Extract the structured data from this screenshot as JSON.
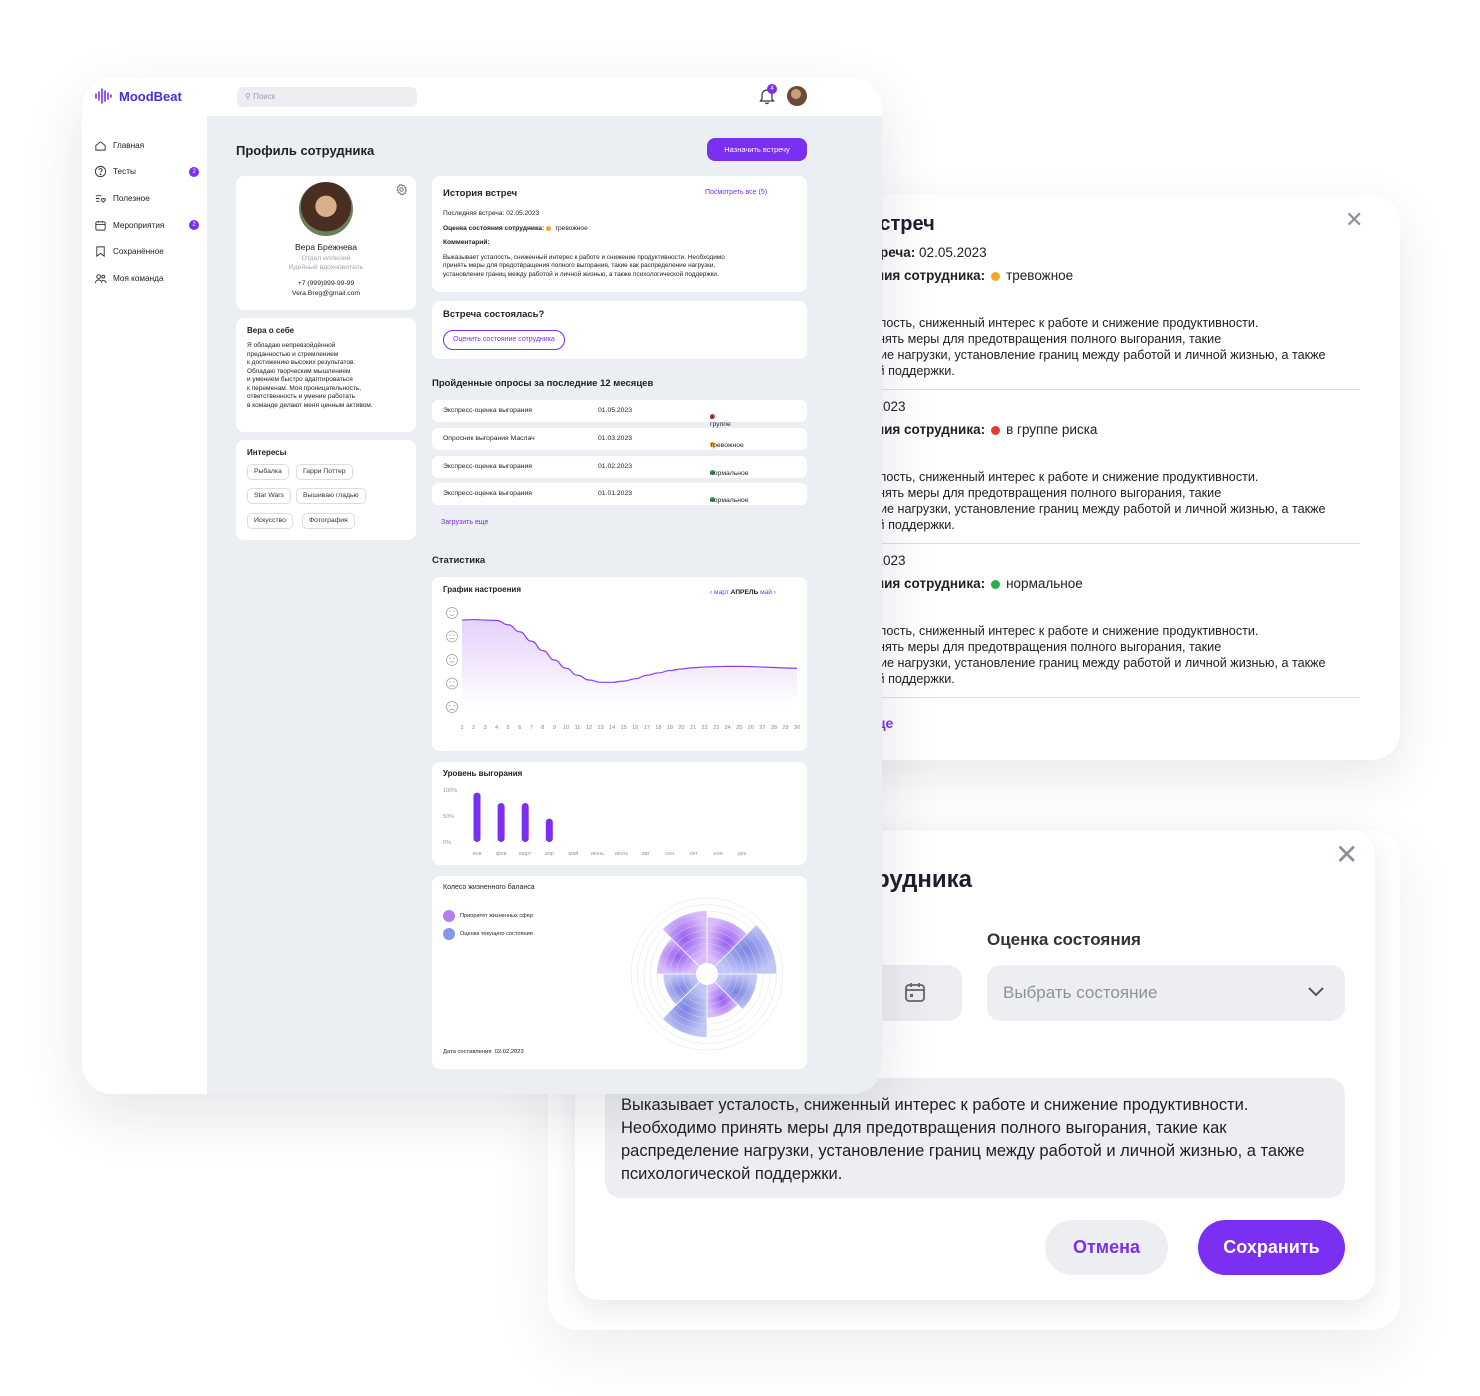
{
  "history_panel": {
    "title": "ия встреч",
    "entries": [
      {
        "date_line": "ия встреча:",
        "date": "02.05.2023",
        "state_label": "остояния сотрудника:",
        "state_color": "#f5a623",
        "state": "тревожное",
        "comment_label": "арий:",
        "lines": [
          "ет усталость, сниженный интерес к работе и снижение продуктивности.",
          "мо принять меры для предотвращения полного выгорания, такие",
          "еделение нагрузки, установление границ между работой и личной жизнью, а также",
          "ической поддержки."
        ]
      },
      {
        "date_line": "",
        "date": "02.04.2023",
        "state_label": "остояния сотрудника:",
        "state_color": "#e53935",
        "state": "в группе риска",
        "comment_label": "арий:",
        "lines": [
          "ет усталость, сниженный интерес к работе и снижение продуктивности.",
          "мо принять меры для предотвращения полного выгорания, такие",
          "еделение нагрузки, установление границ между работой и личной жизнью, а также",
          "ической поддержки."
        ]
      },
      {
        "date_line": "",
        "date": "02.03.2023",
        "state_label": "остояния сотрудника:",
        "state_color": "#22b14c",
        "state": "нормальное",
        "comment_label": "арий:",
        "lines": [
          "ет усталость, сниженный интерес к работе и снижение продуктивности.",
          "мо принять меры для предотвращения полного выгорания, такие",
          "еделение нагрузки, установление границ между работой и личной жизнью, а также",
          "ической поддержки."
        ]
      }
    ],
    "more": "ить еще"
  },
  "edit_panel": {
    "title": "рудника",
    "state_label": "Оценка состояния",
    "select_placeholder": "Выбрать состояние",
    "comment": "Выказывает усталость, сниженный интерес к работе и снижение продуктивности. Необходимо принять меры для предотвращения полного выгорания, такие как распределение нагрузки, установление границ между работой и личной жизнью, а также психологической поддержки.",
    "cancel": "Отмена",
    "save": "Сохранить"
  },
  "app": {
    "brand": "MoodBeat",
    "search_placeholder": "Поиск",
    "notifications": "4",
    "nav": [
      {
        "label": "Главная",
        "icon": "home-icon",
        "badge": ""
      },
      {
        "label": "Тесты",
        "icon": "question-icon",
        "badge": "2"
      },
      {
        "label": "Полезное",
        "icon": "list-heart-icon",
        "badge": ""
      },
      {
        "label": "Мероприятия",
        "icon": "calendar-icon",
        "badge": "2"
      },
      {
        "label": "Сохранённое",
        "icon": "bookmark-icon",
        "badge": ""
      },
      {
        "label": "Моя команда",
        "icon": "team-icon",
        "badge": ""
      }
    ],
    "page_title": "Профиль сотрудника",
    "meet_button": "Назначить встречу",
    "profile": {
      "name": "Вера Брежнева",
      "department": "Отдел иллюзий",
      "role": "Идейный вдохновитель",
      "phone": "+7 (999)999-99-99",
      "email": "Vera.Breg@gmail.com"
    },
    "about": {
      "title": "Вера о себе",
      "lines": [
        "Я обладаю непревзойдённой",
        "преданностью и стремлением",
        "к достижению высоких результатов.",
        "Обладаю творческим мышлением",
        "и умением быстро адаптироваться",
        "к переменам. Моя проницательность,",
        "ответственность и умение работать",
        "в команде делают меня ценным активом."
      ]
    },
    "interests": {
      "title": "Интересы",
      "tags": [
        "Рыбалка",
        "Гарри Поттер",
        "Star Wars",
        "Вышиваю гладью",
        "Искусство",
        "Фотография"
      ]
    },
    "history": {
      "title": "История встреч",
      "view_all": "Посмотреть все (5)",
      "last_label": "Последняя встреча:",
      "last_date": "02.05.2023",
      "state_label": "Оценка состояния сотрудника:",
      "state": "тревожное",
      "state_color": "#f5a623",
      "comment_label": "Комментарий:",
      "lines": [
        "Выказывает усталость, сниженный интерес к работе и снижение продуктивности. Необходимо",
        "принять меры для предотвращения полного выгорания, такие как распределение нагрузки,",
        "установление границ между работой и личной жизнью, а также психологической поддержки."
      ]
    },
    "meeting_done": {
      "title": "Встреча состоялась?",
      "button": "Оценить состояние сотрудника"
    },
    "surveys": {
      "title": "Пройденные опросы за последние 12 месяцев",
      "rows": [
        {
          "name": "Экспресс-оценка выгорания",
          "date": "01.05.2023",
          "status": "в группе риска",
          "color": "#e53935"
        },
        {
          "name": "Опросник выгорания Маслач",
          "date": "01.03.2023",
          "status": "тревожное",
          "color": "#f5a623"
        },
        {
          "name": "Экспресс-оценка выгорания",
          "date": "01.02.2023",
          "status": "нормальное",
          "color": "#22b14c"
        },
        {
          "name": "Экспресс-оценка выгорания",
          "date": "01.01.2023",
          "status": "нормальное",
          "color": "#22b14c"
        }
      ],
      "load_more": "Загрузить еще"
    },
    "stats_title": "Статистика",
    "mood": {
      "title": "График настроения",
      "prev": "март",
      "current": "АПРЕЛЬ",
      "next": "май"
    },
    "burnout": {
      "title": "Уровень выгорания",
      "y_labels": [
        "100%",
        "50%",
        "0%"
      ]
    },
    "wheel": {
      "title": "Колесо жизненного баланса",
      "legend": [
        "Приоритет жизненных сфер",
        "Оценка текущего состояния"
      ],
      "date_label": "Дата составления",
      "date": "02.02.2023"
    }
  },
  "chart_data": [
    {
      "type": "line",
      "title": "График настроения",
      "x": [
        1,
        2,
        3,
        4,
        5,
        6,
        7,
        8,
        9,
        10,
        11,
        12,
        13,
        14,
        15,
        16,
        17,
        18,
        19,
        20,
        21,
        22,
        23,
        24,
        25,
        26,
        27,
        28,
        29,
        30
      ],
      "y_scale": [
        "very-happy-icon",
        "happy-icon",
        "neutral-icon",
        "sad-icon",
        "very-sad-icon"
      ],
      "series": [
        {
          "values": [
            4.7,
            4.72,
            4.7,
            4.68,
            4.5,
            4.2,
            3.8,
            3.4,
            3.0,
            2.65,
            2.35,
            2.15,
            2.05,
            2.05,
            2.1,
            2.2,
            2.35,
            2.45,
            2.55,
            2.62,
            2.67,
            2.7,
            2.72,
            2.73,
            2.73,
            2.72,
            2.7,
            2.68,
            2.66,
            2.65
          ]
        }
      ],
      "ylim": [
        1,
        5
      ]
    },
    {
      "type": "bar",
      "title": "Уровень выгорания",
      "categories": [
        "янв",
        "фев",
        "март",
        "апр",
        "май",
        "июнь",
        "июль",
        "авг",
        "сен",
        "окт",
        "ноя",
        "дек"
      ],
      "values": [
        95,
        75,
        75,
        45,
        0,
        0,
        0,
        0,
        0,
        0,
        0,
        0
      ],
      "ylim": [
        0,
        100
      ]
    }
  ]
}
